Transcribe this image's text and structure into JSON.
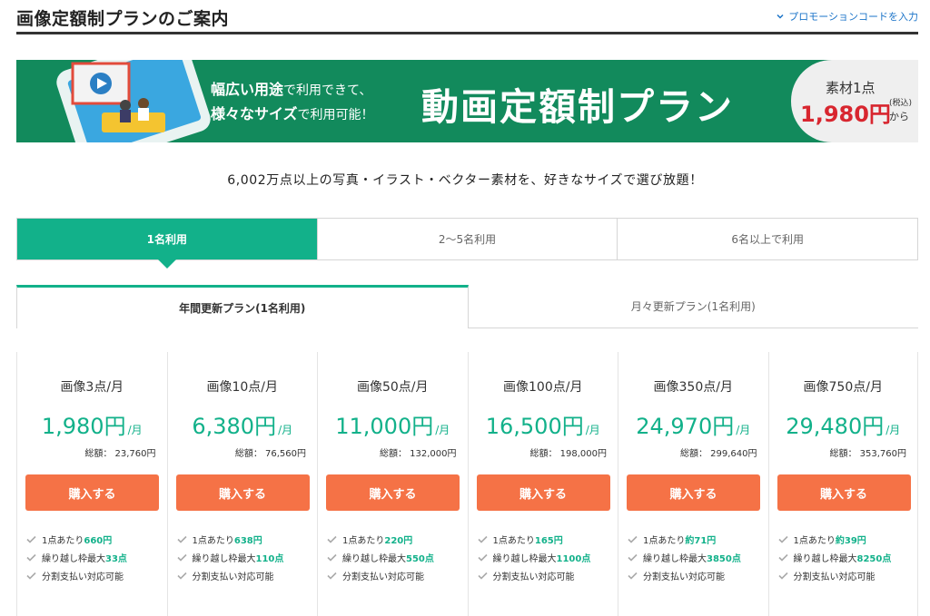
{
  "header": {
    "title": "画像定額制プランのご案内",
    "promo_link": "プロモーションコードを入力"
  },
  "banner": {
    "lead_line1_bold": "幅広い用途",
    "lead_line1_thin": "で利用できて、",
    "lead_line2_bold": "様々なサイズ",
    "lead_line2_thin": "で利用可能！",
    "headline": "動画定額制プラン",
    "per_item": "素材1点",
    "price": "1,980円",
    "tax": "(税込)",
    "from": "から"
  },
  "subtitle": "6,002万点以上の写真・イラスト・ベクター素材を、好きなサイズで選び放題！",
  "user_tabs": [
    {
      "label": "1名利用",
      "active": true
    },
    {
      "label": "2〜5名利用",
      "active": false
    },
    {
      "label": "6名以上で利用",
      "active": false
    }
  ],
  "plan_tabs": [
    {
      "label": "年間更新プラン(1名利用)",
      "active": true
    },
    {
      "label": "月々更新プラン(1名利用)",
      "active": false
    }
  ],
  "cards": [
    {
      "name": "画像3点/月",
      "price": "1,980円",
      "unit": "/月",
      "total": "総額： 23,760円",
      "buy": "購入する",
      "f1_pre": "1点あたり",
      "f1_val": "660円",
      "f2_pre": "繰り越し枠最大",
      "f2_val": "33点",
      "f3": "分割支払い対応可能"
    },
    {
      "name": "画像10点/月",
      "price": "6,380円",
      "unit": "/月",
      "total": "総額： 76,560円",
      "buy": "購入する",
      "f1_pre": "1点あたり",
      "f1_val": "638円",
      "f2_pre": "繰り越し枠最大",
      "f2_val": "110点",
      "f3": "分割支払い対応可能"
    },
    {
      "name": "画像50点/月",
      "price": "11,000円",
      "unit": "/月",
      "total": "総額： 132,000円",
      "buy": "購入する",
      "f1_pre": "1点あたり",
      "f1_val": "220円",
      "f2_pre": "繰り越し枠最大",
      "f2_val": "550点",
      "f3": "分割支払い対応可能"
    },
    {
      "name": "画像100点/月",
      "price": "16,500円",
      "unit": "/月",
      "total": "総額： 198,000円",
      "buy": "購入する",
      "f1_pre": "1点あたり",
      "f1_val": "165円",
      "f2_pre": "繰り越し枠最大",
      "f2_val": "1100点",
      "f3": "分割支払い対応可能"
    },
    {
      "name": "画像350点/月",
      "price": "24,970円",
      "unit": "/月",
      "total": "総額： 299,640円",
      "buy": "購入する",
      "f1_pre": "1点あたり",
      "f1_val": "約71円",
      "f2_pre": "繰り越し枠最大",
      "f2_val": "3850点",
      "f3": "分割支払い対応可能"
    },
    {
      "name": "画像750点/月",
      "price": "29,480円",
      "unit": "/月",
      "total": "総額： 353,760円",
      "buy": "購入する",
      "f1_pre": "1点あたり",
      "f1_val": "約39円",
      "f2_pre": "繰り越し枠最大",
      "f2_val": "8250点",
      "f3": "分割支払い対応可能"
    }
  ],
  "colors": {
    "accent_green": "#12b18a",
    "banner_green": "#128a5c",
    "buy_orange": "#f57246",
    "price_red": "#d8262f",
    "link_blue": "#1a73c8"
  },
  "icons": {
    "promo": "chevron-down-icon",
    "feature": "check-icon"
  }
}
